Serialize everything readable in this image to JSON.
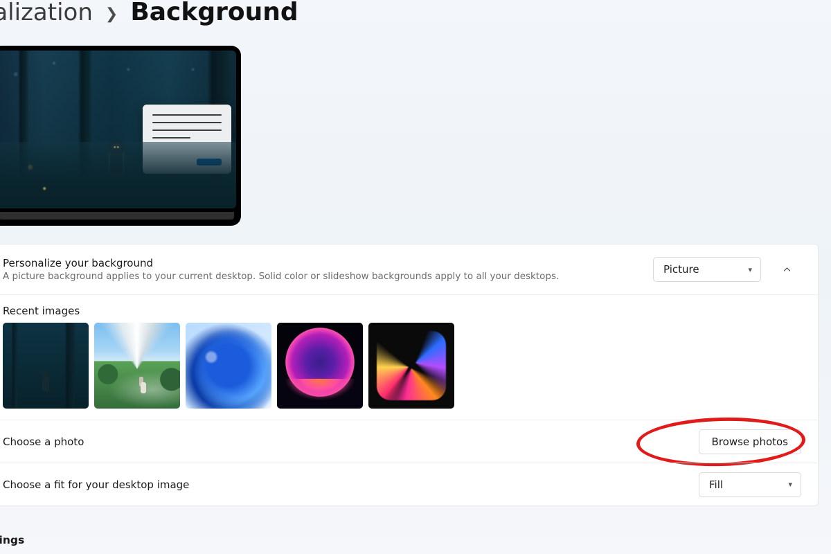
{
  "breadcrumb": {
    "parent": "onalization",
    "current": "Background"
  },
  "personalize": {
    "title": "Personalize your background",
    "sub": "A picture background applies to your current desktop. Solid color or slideshow backgrounds apply to all your desktops.",
    "mode_selected": "Picture"
  },
  "recent": {
    "title": "Recent images"
  },
  "choose_photo": {
    "title": "Choose a photo",
    "button": "Browse photos"
  },
  "choose_fit": {
    "title": "Choose a fit for your desktop image",
    "selected": "Fill"
  },
  "related": {
    "title": "settings"
  }
}
